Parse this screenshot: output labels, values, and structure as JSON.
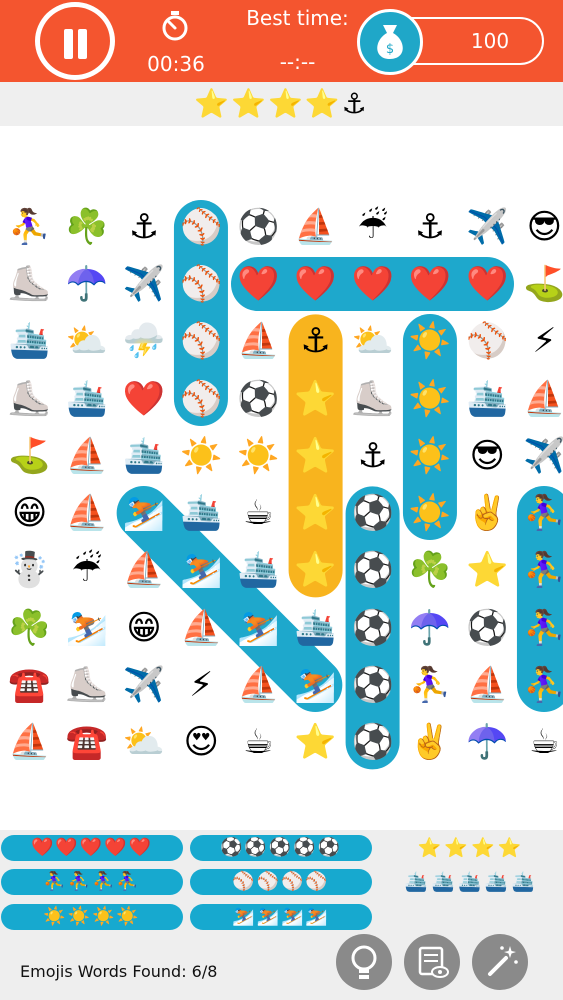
{
  "header": {
    "timer": "00:36",
    "best_time_label": "Best time:",
    "best_time_value": "--:--",
    "coins": "100"
  },
  "rating": "⭐⭐⭐⭐⚓",
  "grid": [
    [
      "⛹️‍♀️",
      "☘️",
      "⚓",
      "⚾",
      "⚽",
      "⛵",
      "☔",
      "⚓",
      "✈️",
      "😎"
    ],
    [
      "⛸️",
      "☂️",
      "✈️",
      "⚾",
      "❤️",
      "❤️",
      "❤️",
      "❤️",
      "❤️",
      "⛳"
    ],
    [
      "🛳️",
      "⛅",
      "⛈️",
      "⚾",
      "⛵",
      "⚓",
      "⛅",
      "☀️",
      "⚾",
      "⚡"
    ],
    [
      "⛸️",
      "🛳️",
      "❤️",
      "⚾",
      "⚽",
      "⭐",
      "⛸️",
      "☀️",
      "🛳️",
      "⛵"
    ],
    [
      "⛳",
      "⛵",
      "🛳️",
      "☀️",
      "☀️",
      "⭐",
      "⚓",
      "☀️",
      "😎",
      "✈️"
    ],
    [
      "😁",
      "⛵",
      "⛷️",
      "🛳️",
      "☕",
      "⭐",
      "⚽",
      "☀️",
      "✌️",
      "⛹️‍♀️"
    ],
    [
      "☃️",
      "☔",
      "⛵",
      "⛷️",
      "🛳️",
      "⭐",
      "⚽",
      "☘️",
      "⭐",
      "⛹️‍♀️"
    ],
    [
      "☘️",
      "⛷️",
      "😁",
      "⛵",
      "⛷️",
      "🛳️",
      "⚽",
      "☂️",
      "⚽",
      "⛹️‍♀️"
    ],
    [
      "☎️",
      "⛸️",
      "✈️",
      "⚡",
      "⛵",
      "⛷️",
      "⚽",
      "⛹️‍♀️",
      "⛵",
      "⛹️‍♀️"
    ],
    [
      "⛵",
      "☎️",
      "⛅",
      "😍",
      "☕",
      "⭐",
      "⚽",
      "✌️",
      "☂️",
      "☕"
    ]
  ],
  "found_words": {
    "hearts": "❤️❤️❤️❤️❤️",
    "soccer": "⚽⚽⚽⚽⚽",
    "players": "⛹️‍♀️⛹️‍♀️⛹️‍♀️⛹️‍♀️",
    "baseballs": "⚾⚾⚾⚾",
    "suns": "☀️☀️☀️☀️",
    "skiers": "⛷️⛷️⛷️⛷️"
  },
  "remaining_words": {
    "stars": "⭐⭐⭐⭐",
    "ships": "🛳️🛳️🛳️🛳️🛳️"
  },
  "status": "Emojis Words Found: 6/8",
  "colors": {
    "topbar": "#f4552f",
    "highlight_blue": "#1ea8cc",
    "highlight_yellow": "#f8b41e",
    "tool_button": "#8a8a8a"
  },
  "icons": {
    "pause": "pause-icon",
    "timer": "stopwatch-icon",
    "coins": "money-bag-icon",
    "hint": "lightbulb-icon",
    "reveal": "list-eye-icon",
    "magic": "magic-wand-icon"
  }
}
